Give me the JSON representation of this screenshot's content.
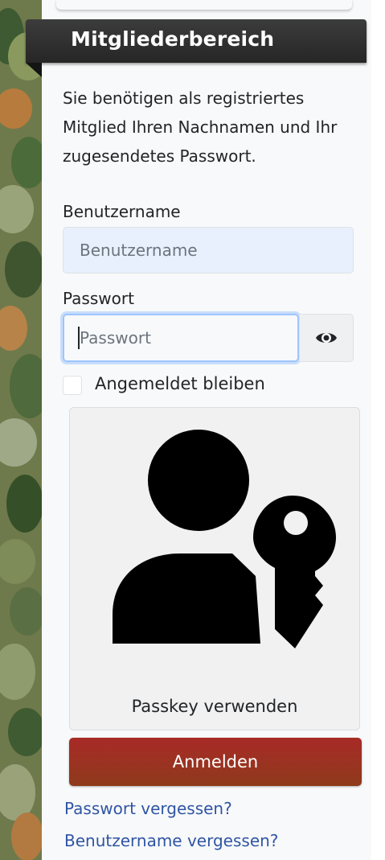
{
  "module": {
    "title": "Mitgliederbereich",
    "intro": "Sie benötigen als registriertes Mitglied Ihren Nachnamen und Ihr zugesendetes Passwort."
  },
  "form": {
    "username_label": "Benutzername",
    "username_placeholder": "Benutzername",
    "password_label": "Passwort",
    "password_placeholder": "Passwort",
    "show_password_icon": "eye-icon",
    "remember_label": "Angemeldet bleiben",
    "passkey_icon": "user-key-icon",
    "passkey_label": "Passkey verwenden",
    "login_label": "Anmelden",
    "forgot_password": "Passwort vergessen?",
    "forgot_username": "Benutzername vergessen?"
  },
  "colors": {
    "title_bar": "#2f2f2f",
    "login_button": "#9b3222",
    "link": "#2f55a4",
    "username_fill": "#e8f0fe",
    "focus_ring": "#9ec5fe"
  }
}
